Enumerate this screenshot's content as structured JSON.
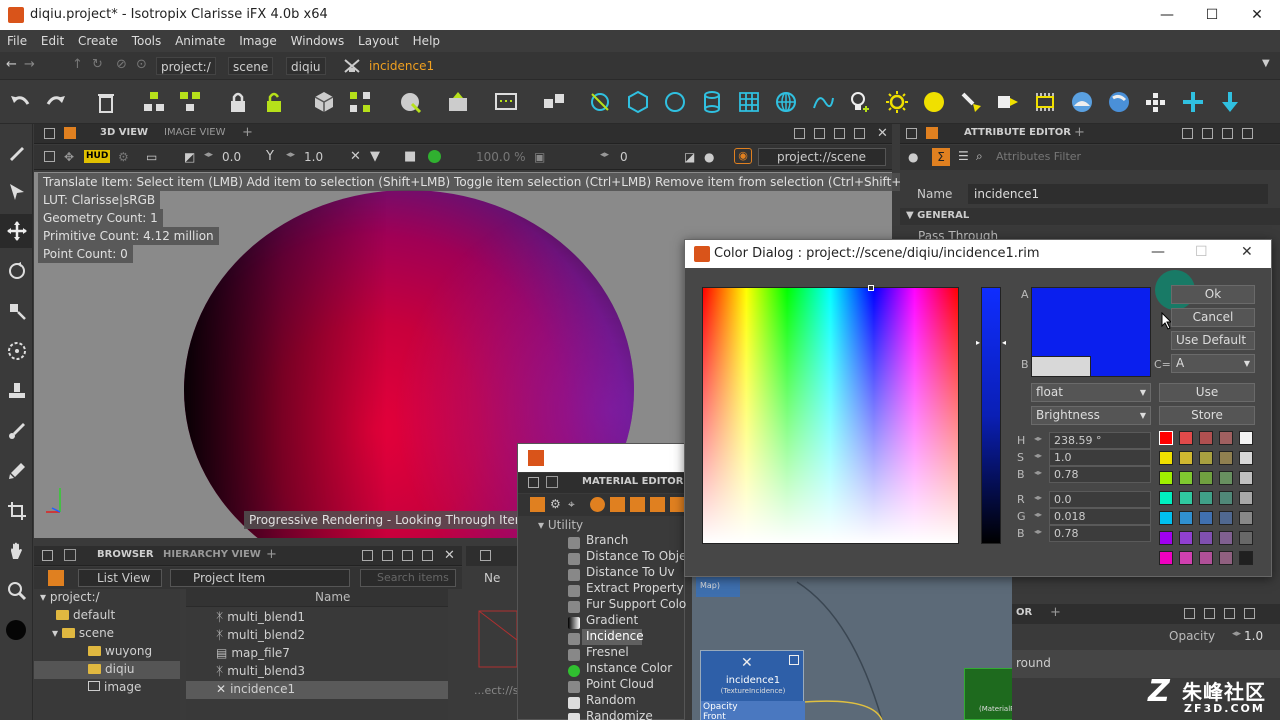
{
  "window": {
    "title": "diqiu.project* - Isotropix Clarisse iFX 4.0b x64",
    "minimize": "—",
    "maximize": "☐",
    "close": "✕"
  },
  "menu": [
    "File",
    "Edit",
    "Create",
    "Tools",
    "Animate",
    "Image",
    "Windows",
    "Layout",
    "Help"
  ],
  "path": [
    "project:/",
    "scene",
    "diqiu",
    "incidence1"
  ],
  "viewport_panel": {
    "tab_active": "3D VIEW",
    "tab_inactive": "IMAGE VIEW",
    "add": "+",
    "hud_value1": "0.0",
    "hud_value2": "1.0",
    "zoom": "100.0 %",
    "frame": "0",
    "look_through": "project://scene",
    "hud_label": "HUD"
  },
  "hud": {
    "hint": "Translate Item: Select item (LMB)  Add item to selection (Shift+LMB)  Toggle item selection (Ctrl+LMB)  Remove item from selection (Ctrl+Shift+LMB)",
    "lut": "LUT: Clarisse|sRGB",
    "geometry": "Geometry Count: 1",
    "primitive": "Primitive Count: 4.12 million",
    "points": "Point Count: 0",
    "progress": "Progressive Rendering - Looking Through Item: pr"
  },
  "attr_editor": {
    "tab": "ATTRIBUTE EDITOR",
    "add": "+",
    "filter_placeholder": "Attributes Filter",
    "name_label": "Name",
    "name_value": "incidence1",
    "section": "GENERAL",
    "pass_through": "Pass Through",
    "opacity_label": "Opacity",
    "opacity_value": "1.0",
    "tab_partial": "OR",
    "round_text": "round"
  },
  "color_dialog": {
    "title": "Color Dialog : project://scene/diqiu/incidence1.rim",
    "label_a": "A",
    "label_b": "B",
    "label_c": "C=",
    "ok": "Ok",
    "cancel": "Cancel",
    "use_default": "Use Default",
    "c_select": "A",
    "type_select": "float",
    "mode_select": "Brightness",
    "use": "Use",
    "store": "Store",
    "h_label": "H",
    "h_value": "238.59 °",
    "s_label": "S",
    "s_value": "1.0",
    "b_label": "B",
    "b_value": "0.78",
    "r_label": "R",
    "r_value": "0.0",
    "g_label": "G",
    "g_value": "0.018",
    "bb_label": "B",
    "bb_value": "0.78",
    "color_a": "#0a1fee",
    "color_b": "#d8d8d8",
    "swatches": [
      [
        "#ff0000",
        "#e04a4a",
        "#b05050",
        "#a06060",
        "#f4f4f4"
      ],
      [
        "#f0e000",
        "#d0b830",
        "#a8a040",
        "#908050",
        "#d8d8d8"
      ],
      [
        "#a0f000",
        "#80c830",
        "#70a040",
        "#689060",
        "#c0c0c0"
      ],
      [
        "#00f0c0",
        "#30c8a0",
        "#40a088",
        "#508878",
        "#a8a8a8"
      ],
      [
        "#00c0f0",
        "#3090d0",
        "#4070b0",
        "#506890",
        "#888888"
      ],
      [
        "#a000f0",
        "#9040d0",
        "#8050b0",
        "#806090",
        "#686868"
      ],
      [
        "#f000c0",
        "#d040b0",
        "#b05098",
        "#906080",
        "#202020"
      ]
    ]
  },
  "browser": {
    "tab_active": "BROWSER",
    "tab_inactive": "HIERARCHY VIEW",
    "add": "+",
    "view_mode": "List View",
    "filter": "Project Item",
    "search_placeholder": "Search items",
    "column_name": "Name",
    "tree": [
      {
        "label": "project:/",
        "depth": 0,
        "type": "root"
      },
      {
        "label": "default",
        "depth": 1,
        "type": "folder"
      },
      {
        "label": "scene",
        "depth": 1,
        "type": "folder"
      },
      {
        "label": "wuyong",
        "depth": 2,
        "type": "folder"
      },
      {
        "label": "diqiu",
        "depth": 2,
        "type": "folder"
      },
      {
        "label": "image",
        "depth": 2,
        "type": "image"
      }
    ],
    "items": [
      "multi_blend1",
      "multi_blend2",
      "map_file7",
      "multi_blend3",
      "incidence1"
    ],
    "partial_panel_label": "Ne",
    "partial_path": "...ect://s"
  },
  "material_editor": {
    "tab": "MATERIAL EDITOR",
    "category": "Utility",
    "items": [
      "Branch",
      "Distance To Obje",
      "Distance To Uv",
      "Extract Property",
      "Fur Support Colo",
      "Gradient",
      "Incidence",
      "Fresnel",
      "Instance Color",
      "Point Cloud",
      "Random",
      "Randomize"
    ]
  },
  "node_graph": {
    "node_title": "incidence1",
    "node_type": "(TextureIncidence)",
    "port1": "Opacity",
    "port2": "Front",
    "side_node": "(MaterialP",
    "map_label": "Map)"
  },
  "watermark": {
    "brand": "朱峰社区",
    "url": "ZF3D.COM"
  }
}
